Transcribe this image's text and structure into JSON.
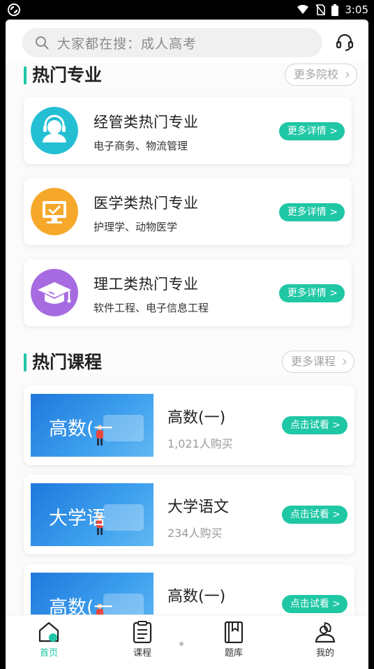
{
  "status_bar": {
    "time": "3:05"
  },
  "search": {
    "placeholder": "大家都在搜：成人高考"
  },
  "majors_section": {
    "title": "热门专业",
    "more_label": "更多院校",
    "items": [
      {
        "title": "经管类热门专业",
        "subtitle": "电子商务、物流管理",
        "button": "更多详情 >",
        "icon": "headset-person-icon",
        "color": "#24bfd3"
      },
      {
        "title": "医学类热门专业",
        "subtitle": "护理学、动物医学",
        "button": "更多详情 >",
        "icon": "monitor-check-icon",
        "color": "#f5a82a"
      },
      {
        "title": "理工类热门专业",
        "subtitle": "软件工程、电子信息工程",
        "button": "更多详情 >",
        "icon": "graduation-cap-icon",
        "color": "#a66be0"
      }
    ]
  },
  "courses_section": {
    "title": "热门课程",
    "more_label": "更多课程",
    "items": [
      {
        "thumb_text": "高数(一",
        "title": "高数(一)",
        "subtitle": "1,021人购买",
        "button": "点击试看 >"
      },
      {
        "thumb_text": "大学语",
        "title": "大学语文",
        "subtitle": "234人购买",
        "button": "点击试看 >"
      },
      {
        "thumb_text": "高数(一",
        "title": "高数(一)",
        "subtitle": "",
        "button": "点击试看 >"
      }
    ]
  },
  "bottom_nav": [
    {
      "label": "首页",
      "icon": "home-icon",
      "active": true
    },
    {
      "label": "课程",
      "icon": "clipboard-icon",
      "active": false
    },
    {
      "label": "题库",
      "icon": "bookmark-book-icon",
      "active": false
    },
    {
      "label": "我的",
      "icon": "person-leaf-icon",
      "active": false
    }
  ],
  "colors": {
    "accent": "#1ec6a6"
  }
}
